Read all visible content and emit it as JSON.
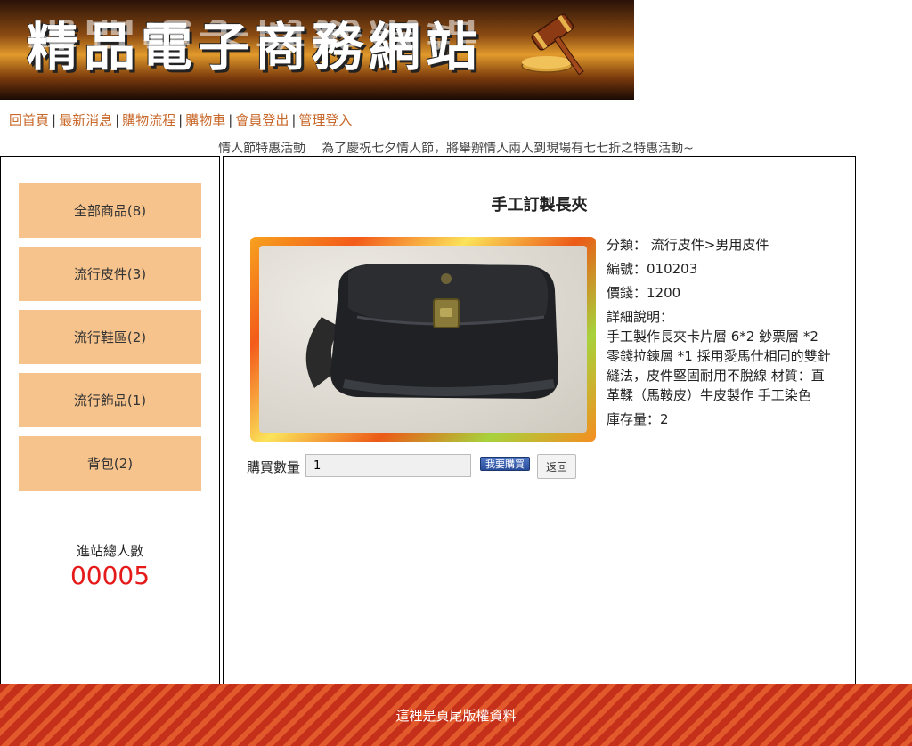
{
  "header": {
    "site_title": "精品電子商務網站",
    "icon": "gavel-icon"
  },
  "nav": {
    "items": [
      {
        "label": "回首頁"
      },
      {
        "label": "最新消息"
      },
      {
        "label": "購物流程"
      },
      {
        "label": "購物車"
      },
      {
        "label": "會員登出"
      },
      {
        "label": "管理登入"
      }
    ],
    "separator": "|"
  },
  "announcement": {
    "title": "情人節特惠活動",
    "text": "為了慶祝七夕情人節，將舉辦情人兩人到現場有七七折之特惠活動~"
  },
  "sidebar": {
    "categories": [
      {
        "label": "全部商品(8)"
      },
      {
        "label": "流行皮件(3)"
      },
      {
        "label": "流行鞋區(2)"
      },
      {
        "label": "流行飾品(1)"
      },
      {
        "label": "背包(2)"
      }
    ],
    "counter_label": "進站總人數",
    "counter_value": "00005"
  },
  "product": {
    "name": "手工訂製長夾",
    "category": "分類： 流行皮件>男用皮件",
    "code": "編號：010203",
    "price": "價錢：1200",
    "detail_label": "詳細說明：",
    "detail_text": "手工製作長夾卡片層 6*2 鈔票層 *2 零錢拉鍊層 *1 採用愛馬仕相同的雙針縫法，皮件堅固耐用不脫線 材質：直革鞣（馬鞍皮）牛皮製作 手工染色",
    "stock": "庫存量：2"
  },
  "purchase": {
    "qty_label": "購買數量",
    "qty_value": "1",
    "buy_label": "我要購買",
    "back_label": "返回"
  },
  "footer": {
    "text": "這裡是頁尾版權資料"
  },
  "colors": {
    "nav_link": "#c8682a",
    "category_bg": "#f6c38c",
    "counter": "#e51a1a",
    "footer_bg": "#c4301a"
  }
}
